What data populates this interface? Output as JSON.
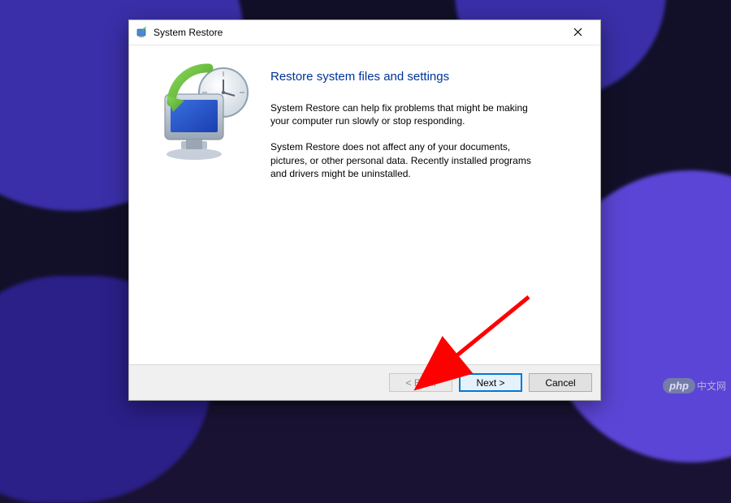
{
  "window": {
    "title": "System Restore"
  },
  "content": {
    "headline": "Restore system files and settings",
    "paragraph1": "System Restore can help fix problems that might be making your computer run slowly or stop responding.",
    "paragraph2": "System Restore does not affect any of your documents, pictures, or other personal data. Recently installed programs and drivers might be uninstalled."
  },
  "buttons": {
    "back": "< Back",
    "next": "Next >",
    "cancel": "Cancel"
  },
  "watermark": {
    "pill": "php",
    "text": "中文网"
  }
}
